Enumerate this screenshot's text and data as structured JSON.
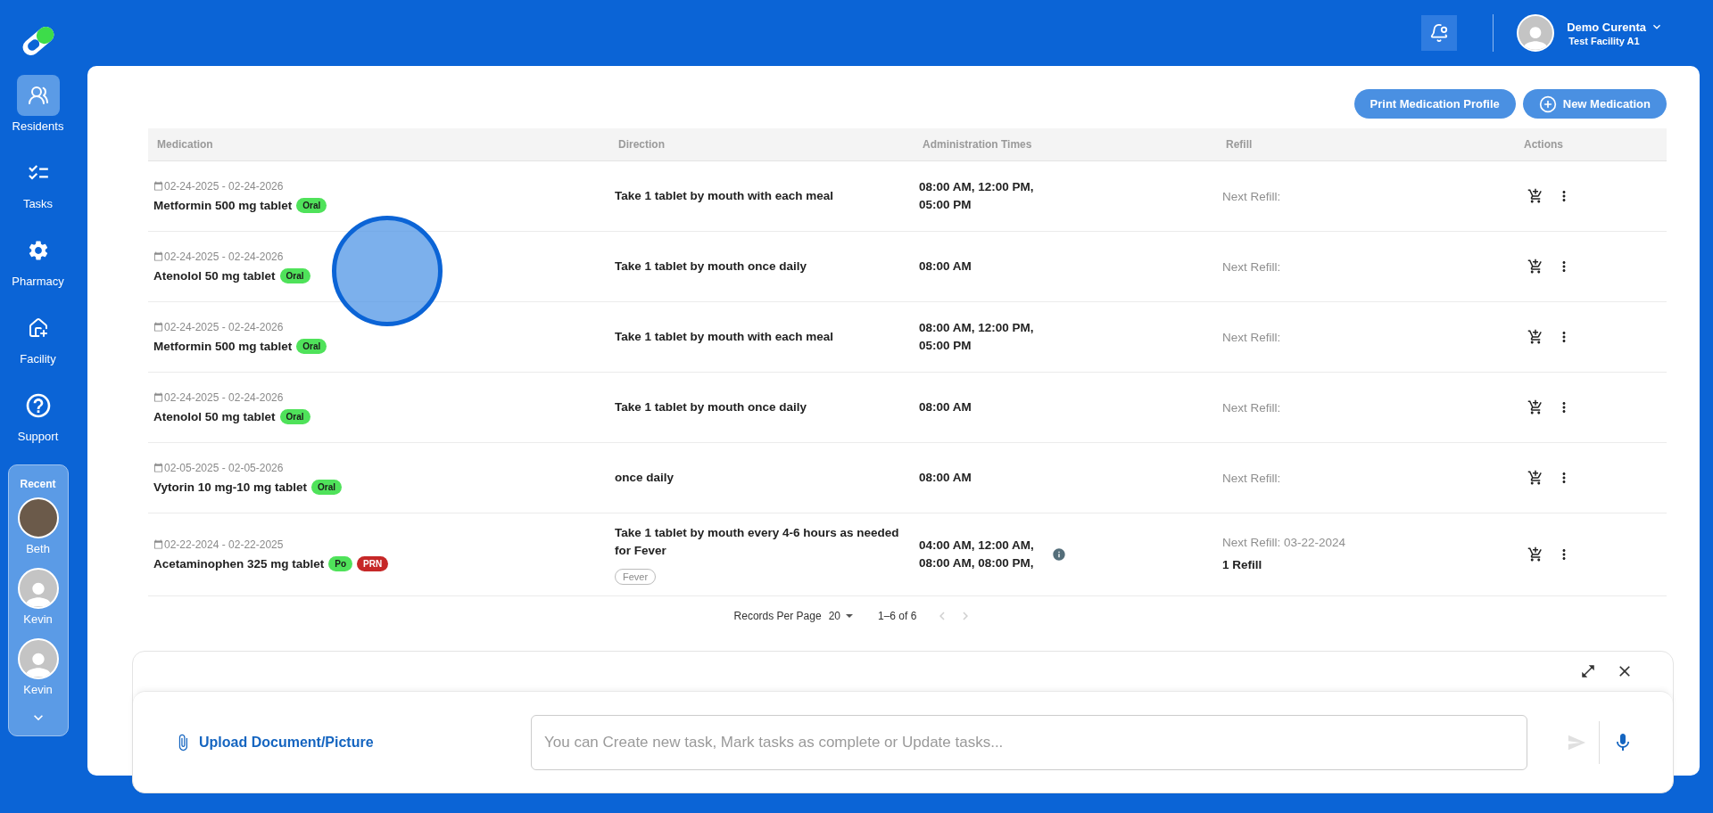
{
  "sidebar": {
    "items": [
      {
        "label": "Residents",
        "kind": "residents",
        "selected": true
      },
      {
        "label": "Tasks",
        "kind": "tasks",
        "selected": false
      },
      {
        "label": "Pharmacy",
        "kind": "pharmacy",
        "selected": false
      },
      {
        "label": "Facility",
        "kind": "facility",
        "selected": false
      },
      {
        "label": "Support",
        "kind": "support",
        "selected": false
      }
    ],
    "recent": {
      "title": "Recent",
      "people": [
        {
          "name": "Beth",
          "kind": "photo"
        },
        {
          "name": "Kevin",
          "kind": "default"
        },
        {
          "name": "Kevin",
          "kind": "default"
        }
      ]
    }
  },
  "header": {
    "user_name": "Demo Curenta",
    "facility": "Test Facility A1"
  },
  "toolbar": {
    "buttons": [
      {
        "label": "Print Medication Profile",
        "kind": "plain"
      },
      {
        "label": "New Medication",
        "kind": "add"
      }
    ]
  },
  "table": {
    "columns": [
      "Medication",
      "Direction",
      "Administration Times",
      "Refill",
      "Actions"
    ],
    "rows": [
      {
        "dates": "02-24-2025 - 02-24-2026",
        "name": "Metformin 500 mg tablet",
        "tags": [
          {
            "label": "Oral",
            "color": "#4fe25a"
          }
        ],
        "direction": "Take 1 tablet by mouth with each meal",
        "times": "08:00 AM, 12:00 PM, 05:00 PM",
        "info": false,
        "refill": "Next Refill:"
      },
      {
        "dates": "02-24-2025 - 02-24-2026",
        "name": "Atenolol 50 mg tablet",
        "tags": [
          {
            "label": "Oral",
            "color": "#4fe25a"
          }
        ],
        "direction": "Take 1 tablet by mouth once daily",
        "times": "08:00 AM",
        "info": false,
        "refill": "Next Refill:"
      },
      {
        "dates": "02-24-2025 - 02-24-2026",
        "name": "Metformin 500 mg tablet",
        "tags": [
          {
            "label": "Oral",
            "color": "#4fe25a"
          }
        ],
        "direction": "Take 1 tablet by mouth with each meal",
        "times": "08:00 AM, 12:00 PM, 05:00 PM",
        "info": false,
        "refill": "Next Refill:"
      },
      {
        "dates": "02-24-2025 - 02-24-2026",
        "name": "Atenolol 50 mg tablet",
        "tags": [
          {
            "label": "Oral",
            "color": "#4fe25a"
          }
        ],
        "direction": "Take 1 tablet by mouth once daily",
        "times": "08:00 AM",
        "info": false,
        "refill": "Next Refill:"
      },
      {
        "dates": "02-05-2025 - 02-05-2026",
        "name": "Vytorin 10 mg-10 mg tablet",
        "tags": [
          {
            "label": "Oral",
            "color": "#4fe25a"
          }
        ],
        "direction": "once daily",
        "times": "08:00 AM",
        "info": false,
        "refill": "Next Refill:"
      },
      {
        "dates": "02-22-2024 - 02-22-2025",
        "name": "Acetaminophen 325 mg tablet",
        "tags": [
          {
            "label": "Po",
            "color": "#4fe25a"
          },
          {
            "label": "PRN",
            "color": "#c62828"
          }
        ],
        "direction": "Take 1 tablet by mouth every 4-6 hours as needed for Fever",
        "indication": "Fever",
        "times": "04:00 AM, 12:00 AM, 08:00 AM, 08:00 PM,",
        "info": true,
        "refill": "Next Refill: 03-22-2024",
        "refill_count": "1 Refill"
      }
    ]
  },
  "pagination": {
    "label": "Records Per Page",
    "per_page": "20",
    "range": "1–6 of 6"
  },
  "assistant": {
    "upload": "Upload Document/Picture",
    "placeholder": "You can Create new task, Mark tasks as complete or Update tasks..."
  }
}
